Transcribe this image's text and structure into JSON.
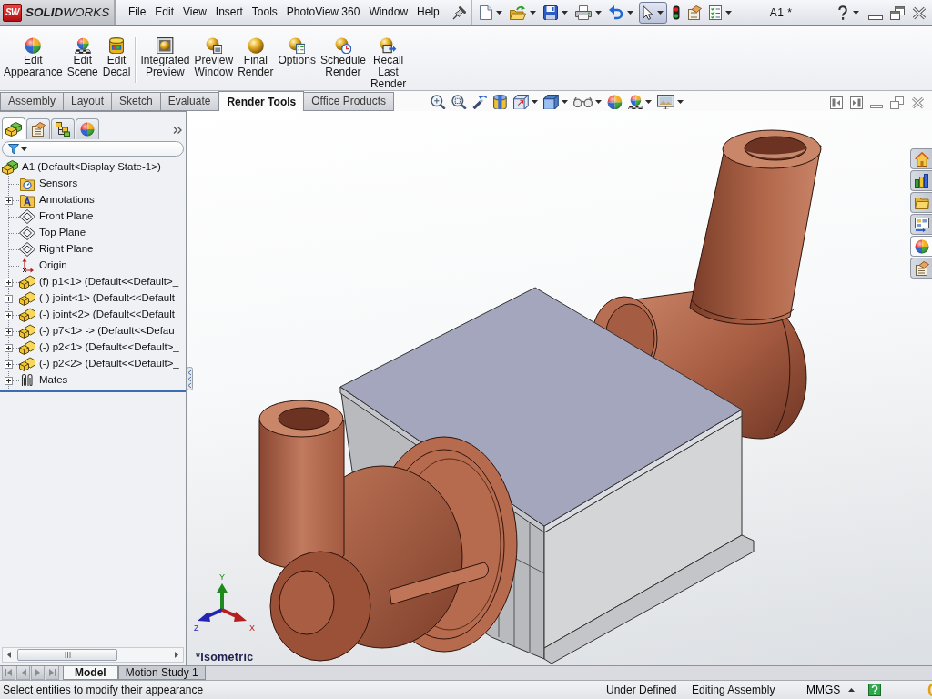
{
  "title_bar": {
    "logo": {
      "badge": "SW",
      "wordmark": "**SOLID**WORKS"
    },
    "menus": [
      "File",
      "Edit",
      "View",
      "Insert",
      "Tools",
      "PhotoView 360",
      "Window",
      "Help"
    ],
    "quick_access": [
      {
        "kind": "new",
        "dropdown": true,
        "pressed": false
      },
      {
        "kind": "open",
        "dropdown": true,
        "pressed": false
      },
      {
        "kind": "save",
        "dropdown": true,
        "pressed": false
      },
      {
        "kind": "print",
        "dropdown": true,
        "pressed": false
      },
      {
        "kind": "undo",
        "dropdown": true,
        "pressed": false
      },
      {
        "kind": "select",
        "dropdown": true,
        "pressed": true
      },
      {
        "kind": "rebuild",
        "dropdown": false,
        "pressed": false
      },
      {
        "kind": "file-properties",
        "dropdown": false,
        "pressed": false
      },
      {
        "kind": "options",
        "dropdown": true,
        "pressed": false
      }
    ],
    "document_title": "A1 *",
    "help_button": {
      "dropdown": true
    }
  },
  "ribbon": {
    "groups": [
      {
        "buttons": [
          {
            "kind": "edit-appearance",
            "lines": [
              "Edit",
              "Appearance"
            ]
          },
          {
            "kind": "edit-scene",
            "lines": [
              "Edit",
              "Scene"
            ]
          },
          {
            "kind": "edit-decal",
            "lines": [
              "Edit",
              "Decal"
            ]
          }
        ]
      },
      {
        "buttons": [
          {
            "kind": "integrated-preview",
            "lines": [
              "Integrated",
              "Preview"
            ]
          },
          {
            "kind": "preview-window",
            "lines": [
              "Preview",
              "Window"
            ]
          },
          {
            "kind": "final-render",
            "lines": [
              "Final",
              "Render"
            ]
          },
          {
            "kind": "options",
            "lines": [
              "Options"
            ]
          },
          {
            "kind": "schedule-render",
            "lines": [
              "Schedule",
              "Render"
            ]
          },
          {
            "kind": "recall-last-render",
            "lines": [
              "Recall",
              "Last",
              "Render"
            ]
          }
        ]
      }
    ]
  },
  "command_tabs": [
    {
      "label": "Assembly",
      "selected": false
    },
    {
      "label": "Layout",
      "selected": false
    },
    {
      "label": "Sketch",
      "selected": false
    },
    {
      "label": "Evaluate",
      "selected": false
    },
    {
      "label": "Render Tools",
      "selected": true
    },
    {
      "label": "Office Products",
      "selected": false
    }
  ],
  "view_toolbar": [
    {
      "kind": "zoom-fit",
      "dropdown": false
    },
    {
      "kind": "zoom-area",
      "dropdown": false
    },
    {
      "kind": "previous-view",
      "dropdown": false
    },
    {
      "kind": "section-view",
      "dropdown": false
    },
    {
      "kind": "view-orientation",
      "dropdown": true
    },
    {
      "kind": "display-style",
      "dropdown": true
    },
    {
      "kind": "hide-show",
      "dropdown": true
    },
    {
      "kind": "edit-appearance",
      "dropdown": false
    },
    {
      "kind": "apply-scene",
      "dropdown": true
    },
    {
      "kind": "view-settings",
      "dropdown": true
    }
  ],
  "feature_manager": {
    "tabs": [
      {
        "kind": "feature-manager",
        "selected": true
      },
      {
        "kind": "property-manager",
        "selected": false
      },
      {
        "kind": "configuration-manager",
        "selected": false
      },
      {
        "kind": "display-manager",
        "selected": false
      }
    ],
    "tree": {
      "kind": "assembly",
      "label": "A1 (Default<Display State-1>)",
      "children": [
        {
          "kind": "sensors",
          "label": "Sensors"
        },
        {
          "kind": "annotations",
          "label": "Annotations",
          "expanded": false
        },
        {
          "kind": "plane",
          "label": "Front Plane"
        },
        {
          "kind": "plane",
          "label": "Top Plane"
        },
        {
          "kind": "plane",
          "label": "Right Plane"
        },
        {
          "kind": "origin",
          "label": "Origin"
        },
        {
          "kind": "part",
          "label": "(f) p1<1> (Default<<Default>_",
          "expanded": false
        },
        {
          "kind": "part",
          "label": "(-) joint<1> (Default<<Default",
          "expanded": false
        },
        {
          "kind": "part",
          "label": "(-) joint<2> (Default<<Default",
          "expanded": false
        },
        {
          "kind": "part",
          "label": "(-) p7<1> -> (Default<<Defau",
          "expanded": false
        },
        {
          "kind": "part",
          "label": "(-) p2<1> (Default<<Default>_",
          "expanded": false
        },
        {
          "kind": "part",
          "label": "(-) p2<2> (Default<<Default>_",
          "expanded": false
        },
        {
          "kind": "mates",
          "label": "Mates",
          "expanded": false
        }
      ]
    }
  },
  "task_pane": [
    {
      "kind": "resources",
      "selected": false
    },
    {
      "kind": "design-library",
      "selected": false
    },
    {
      "kind": "file-explorer",
      "selected": false
    },
    {
      "kind": "view-palette",
      "selected": false
    },
    {
      "kind": "appearances",
      "selected": true
    },
    {
      "kind": "custom-properties",
      "selected": false
    }
  ],
  "viewport": {
    "triad": {
      "x": "X",
      "y": "Y",
      "z": "Z"
    },
    "view_name": "*Isometric"
  },
  "bottom_tabs": [
    {
      "label": "Model",
      "selected": true
    },
    {
      "label": "Motion Study 1",
      "selected": false
    }
  ],
  "status_bar": {
    "message": "Select entities to modify their appearance",
    "definition": "Under Defined",
    "mode": "Editing Assembly",
    "units": "MMGS"
  }
}
